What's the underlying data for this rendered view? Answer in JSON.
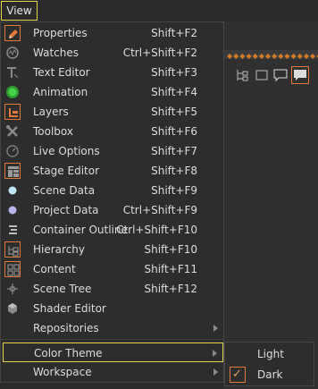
{
  "menubar": {
    "view_label": "View"
  },
  "background": {
    "dots": "◆◆◆◆◆◆◆◆◆◆◆◆◆◆◆"
  },
  "menu": {
    "items": [
      {
        "label": "Properties",
        "shortcut": "Shift+F2",
        "icon": "properties-icon"
      },
      {
        "label": "Watches",
        "shortcut": "Ctrl+Shift+F2",
        "icon": "watches-icon"
      },
      {
        "label": "Text Editor",
        "shortcut": "Shift+F3",
        "icon": "text-editor-icon"
      },
      {
        "label": "Animation",
        "shortcut": "Shift+F4",
        "icon": "animation-icon"
      },
      {
        "label": "Layers",
        "shortcut": "Shift+F5",
        "icon": "layers-icon"
      },
      {
        "label": "Toolbox",
        "shortcut": "Shift+F6",
        "icon": "toolbox-icon"
      },
      {
        "label": "Live Options",
        "shortcut": "Shift+F7",
        "icon": "live-options-icon"
      },
      {
        "label": "Stage Editor",
        "shortcut": "Shift+F8",
        "icon": "stage-editor-icon"
      },
      {
        "label": "Scene Data",
        "shortcut": "Shift+F9",
        "icon": "scene-data-icon"
      },
      {
        "label": "Project Data",
        "shortcut": "Ctrl+Shift+F9",
        "icon": "project-data-icon"
      },
      {
        "label": "Container Outline",
        "shortcut": "Ctrl+Shift+F10",
        "icon": "container-outline-icon"
      },
      {
        "label": "Hierarchy",
        "shortcut": "Shift+F10",
        "icon": "hierarchy-icon"
      },
      {
        "label": "Content",
        "shortcut": "Shift+F11",
        "icon": "content-icon"
      },
      {
        "label": "Scene Tree",
        "shortcut": "Shift+F12",
        "icon": "scene-tree-icon"
      },
      {
        "label": "Shader Editor",
        "shortcut": "",
        "icon": "shader-editor-icon"
      },
      {
        "label": "Repositories",
        "shortcut": "",
        "icon": ""
      }
    ],
    "color_theme": {
      "label": "Color Theme"
    },
    "workspace": {
      "label": "Workspace"
    }
  },
  "submenu": {
    "light": {
      "label": "Light"
    },
    "dark": {
      "label": "Dark",
      "checked": true,
      "check_glyph": "✓"
    }
  },
  "colors": {
    "accent": "#e0793a",
    "highlight": "#e6d34a",
    "menu_bg": "#2d2d2d"
  }
}
